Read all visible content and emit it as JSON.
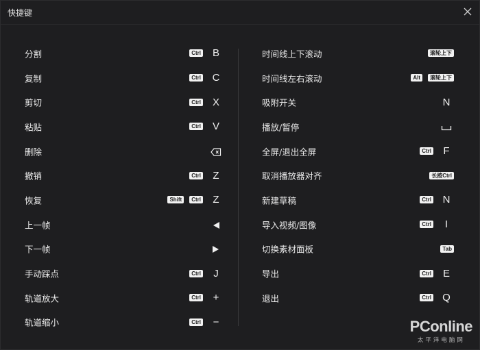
{
  "dialog": {
    "title": "快捷键"
  },
  "left": [
    {
      "label": "分割",
      "keys": [
        {
          "type": "kbd",
          "text": "Ctrl"
        },
        {
          "type": "letter",
          "text": "B"
        }
      ]
    },
    {
      "label": "复制",
      "keys": [
        {
          "type": "kbd",
          "text": "Ctrl"
        },
        {
          "type": "letter",
          "text": "C"
        }
      ]
    },
    {
      "label": "剪切",
      "keys": [
        {
          "type": "kbd",
          "text": "Ctrl"
        },
        {
          "type": "letter",
          "text": "X"
        }
      ]
    },
    {
      "label": "粘贴",
      "keys": [
        {
          "type": "kbd",
          "text": "Ctrl"
        },
        {
          "type": "letter",
          "text": "V"
        }
      ]
    },
    {
      "label": "删除",
      "keys": [
        {
          "type": "icon",
          "icon": "backspace-icon"
        }
      ]
    },
    {
      "label": "撤销",
      "keys": [
        {
          "type": "kbd",
          "text": "Ctrl"
        },
        {
          "type": "letter",
          "text": "Z"
        }
      ]
    },
    {
      "label": "恢复",
      "keys": [
        {
          "type": "kbd",
          "text": "Shift"
        },
        {
          "type": "kbd",
          "text": "Ctrl"
        },
        {
          "type": "letter",
          "text": "Z"
        }
      ]
    },
    {
      "label": "上一帧",
      "keys": [
        {
          "type": "icon",
          "icon": "left-arrow-icon"
        }
      ]
    },
    {
      "label": "下一帧",
      "keys": [
        {
          "type": "icon",
          "icon": "right-arrow-icon"
        }
      ]
    },
    {
      "label": "手动踩点",
      "keys": [
        {
          "type": "kbd",
          "text": "Ctrl"
        },
        {
          "type": "letter",
          "text": "J"
        }
      ]
    },
    {
      "label": "轨道放大",
      "keys": [
        {
          "type": "kbd",
          "text": "Ctrl"
        },
        {
          "type": "letter",
          "text": "+"
        }
      ]
    },
    {
      "label": "轨道缩小",
      "keys": [
        {
          "type": "kbd",
          "text": "Ctrl"
        },
        {
          "type": "letter",
          "text": "−"
        }
      ]
    }
  ],
  "right": [
    {
      "label": "时间线上下滚动",
      "keys": [
        {
          "type": "kbd",
          "text": "滚轮上下"
        }
      ]
    },
    {
      "label": "时间线左右滚动",
      "keys": [
        {
          "type": "kbd",
          "text": "Alt"
        },
        {
          "type": "kbd",
          "text": "滚轮上下"
        }
      ]
    },
    {
      "label": "吸附开关",
      "keys": [
        {
          "type": "letter",
          "text": "N"
        }
      ]
    },
    {
      "label": "播放/暂停",
      "keys": [
        {
          "type": "icon",
          "icon": "space-bar-icon"
        }
      ]
    },
    {
      "label": "全屏/退出全屏",
      "keys": [
        {
          "type": "kbd",
          "text": "Ctrl"
        },
        {
          "type": "letter",
          "text": "F"
        }
      ]
    },
    {
      "label": "取消播放器对齐",
      "keys": [
        {
          "type": "kbd",
          "text": "长按Ctrl"
        }
      ]
    },
    {
      "label": "新建草稿",
      "keys": [
        {
          "type": "kbd",
          "text": "Ctrl"
        },
        {
          "type": "letter",
          "text": "N"
        }
      ]
    },
    {
      "label": "导入视频/图像",
      "keys": [
        {
          "type": "kbd",
          "text": "Ctrl"
        },
        {
          "type": "letter",
          "text": "I"
        }
      ]
    },
    {
      "label": "切换素材面板",
      "keys": [
        {
          "type": "kbd",
          "text": "Tab"
        }
      ]
    },
    {
      "label": "导出",
      "keys": [
        {
          "type": "kbd",
          "text": "Ctrl"
        },
        {
          "type": "letter",
          "text": "E"
        }
      ]
    },
    {
      "label": "退出",
      "keys": [
        {
          "type": "kbd",
          "text": "Ctrl"
        },
        {
          "type": "letter",
          "text": "Q"
        }
      ]
    }
  ],
  "watermark": {
    "main": "PConline",
    "sub": "太平洋电脑网"
  }
}
